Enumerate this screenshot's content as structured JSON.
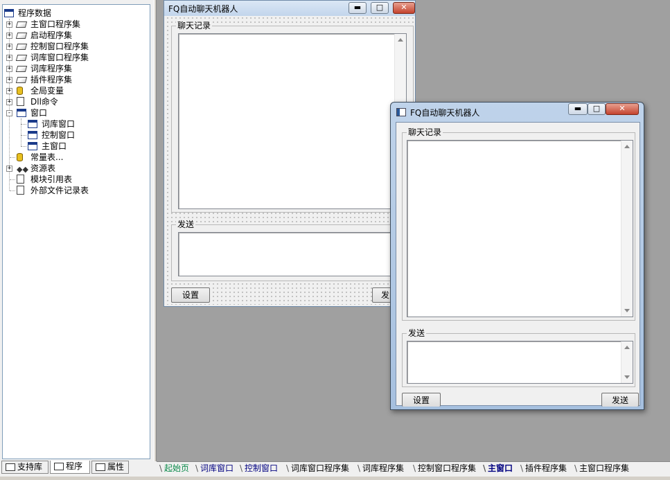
{
  "tree": {
    "root": "程序数据",
    "items": [
      {
        "label": "主窗口程序集",
        "icon": "book-icon",
        "expander": "+"
      },
      {
        "label": "启动程序集",
        "icon": "book-icon",
        "expander": "+"
      },
      {
        "label": "控制窗口程序集",
        "icon": "book-icon",
        "expander": "+"
      },
      {
        "label": "词库窗口程序集",
        "icon": "book-icon",
        "expander": "+"
      },
      {
        "label": "词库程序集",
        "icon": "book-icon",
        "expander": "+"
      },
      {
        "label": "插件程序集",
        "icon": "book-icon",
        "expander": "+"
      },
      {
        "label": "全局变量",
        "icon": "database-icon",
        "expander": "+"
      },
      {
        "label": "Dll命令",
        "icon": "dll-icon",
        "expander": "+"
      },
      {
        "label": "窗口",
        "icon": "window-icon",
        "expander": "-"
      },
      {
        "label": "词库窗口",
        "icon": "window-icon",
        "child": true
      },
      {
        "label": "控制窗口",
        "icon": "window-icon",
        "child": true
      },
      {
        "label": "主窗口",
        "icon": "window-icon",
        "child": true
      },
      {
        "label": "常量表...",
        "icon": "constants-icon"
      },
      {
        "label": "资源表",
        "icon": "resource-icon",
        "expander": "+"
      },
      {
        "label": "模块引用表",
        "icon": "module-icon"
      },
      {
        "label": "外部文件记录表",
        "icon": "file-icon"
      }
    ]
  },
  "left_tabs": [
    "支持库",
    "程序",
    "属性"
  ],
  "design_form": {
    "title": "FQ自动聊天机器人",
    "chat_group": "聊天记录",
    "send_group": "发送",
    "settings_button": "设置",
    "send_button": "发"
  },
  "preview_window": {
    "title": "FQ自动聊天机器人",
    "chat_group": "聊天记录",
    "send_group": "发送",
    "settings_button": "设置",
    "send_button": "发送"
  },
  "window_buttons": {
    "minimize": "▬",
    "maximize": "□",
    "close": "✕"
  },
  "bottom_tabs": [
    {
      "label": "起始页",
      "state": "first"
    },
    {
      "label": "词库窗口",
      "state": "normal"
    },
    {
      "label": "控制窗口",
      "state": "normal"
    },
    {
      "label": "词库窗口程序集",
      "state": "plain"
    },
    {
      "label": "词库程序集",
      "state": "plain"
    },
    {
      "label": "控制窗口程序集",
      "state": "plain"
    },
    {
      "label": "主窗口",
      "state": "active"
    },
    {
      "label": "插件程序集",
      "state": "plain"
    },
    {
      "label": "主窗口程序集",
      "state": "plain"
    }
  ],
  "colors": {
    "design_bg": "#a0a0a0",
    "title_gradient": "#c2d5ec",
    "tab_green": "#0a8a4a",
    "tab_blue": "#000080"
  }
}
